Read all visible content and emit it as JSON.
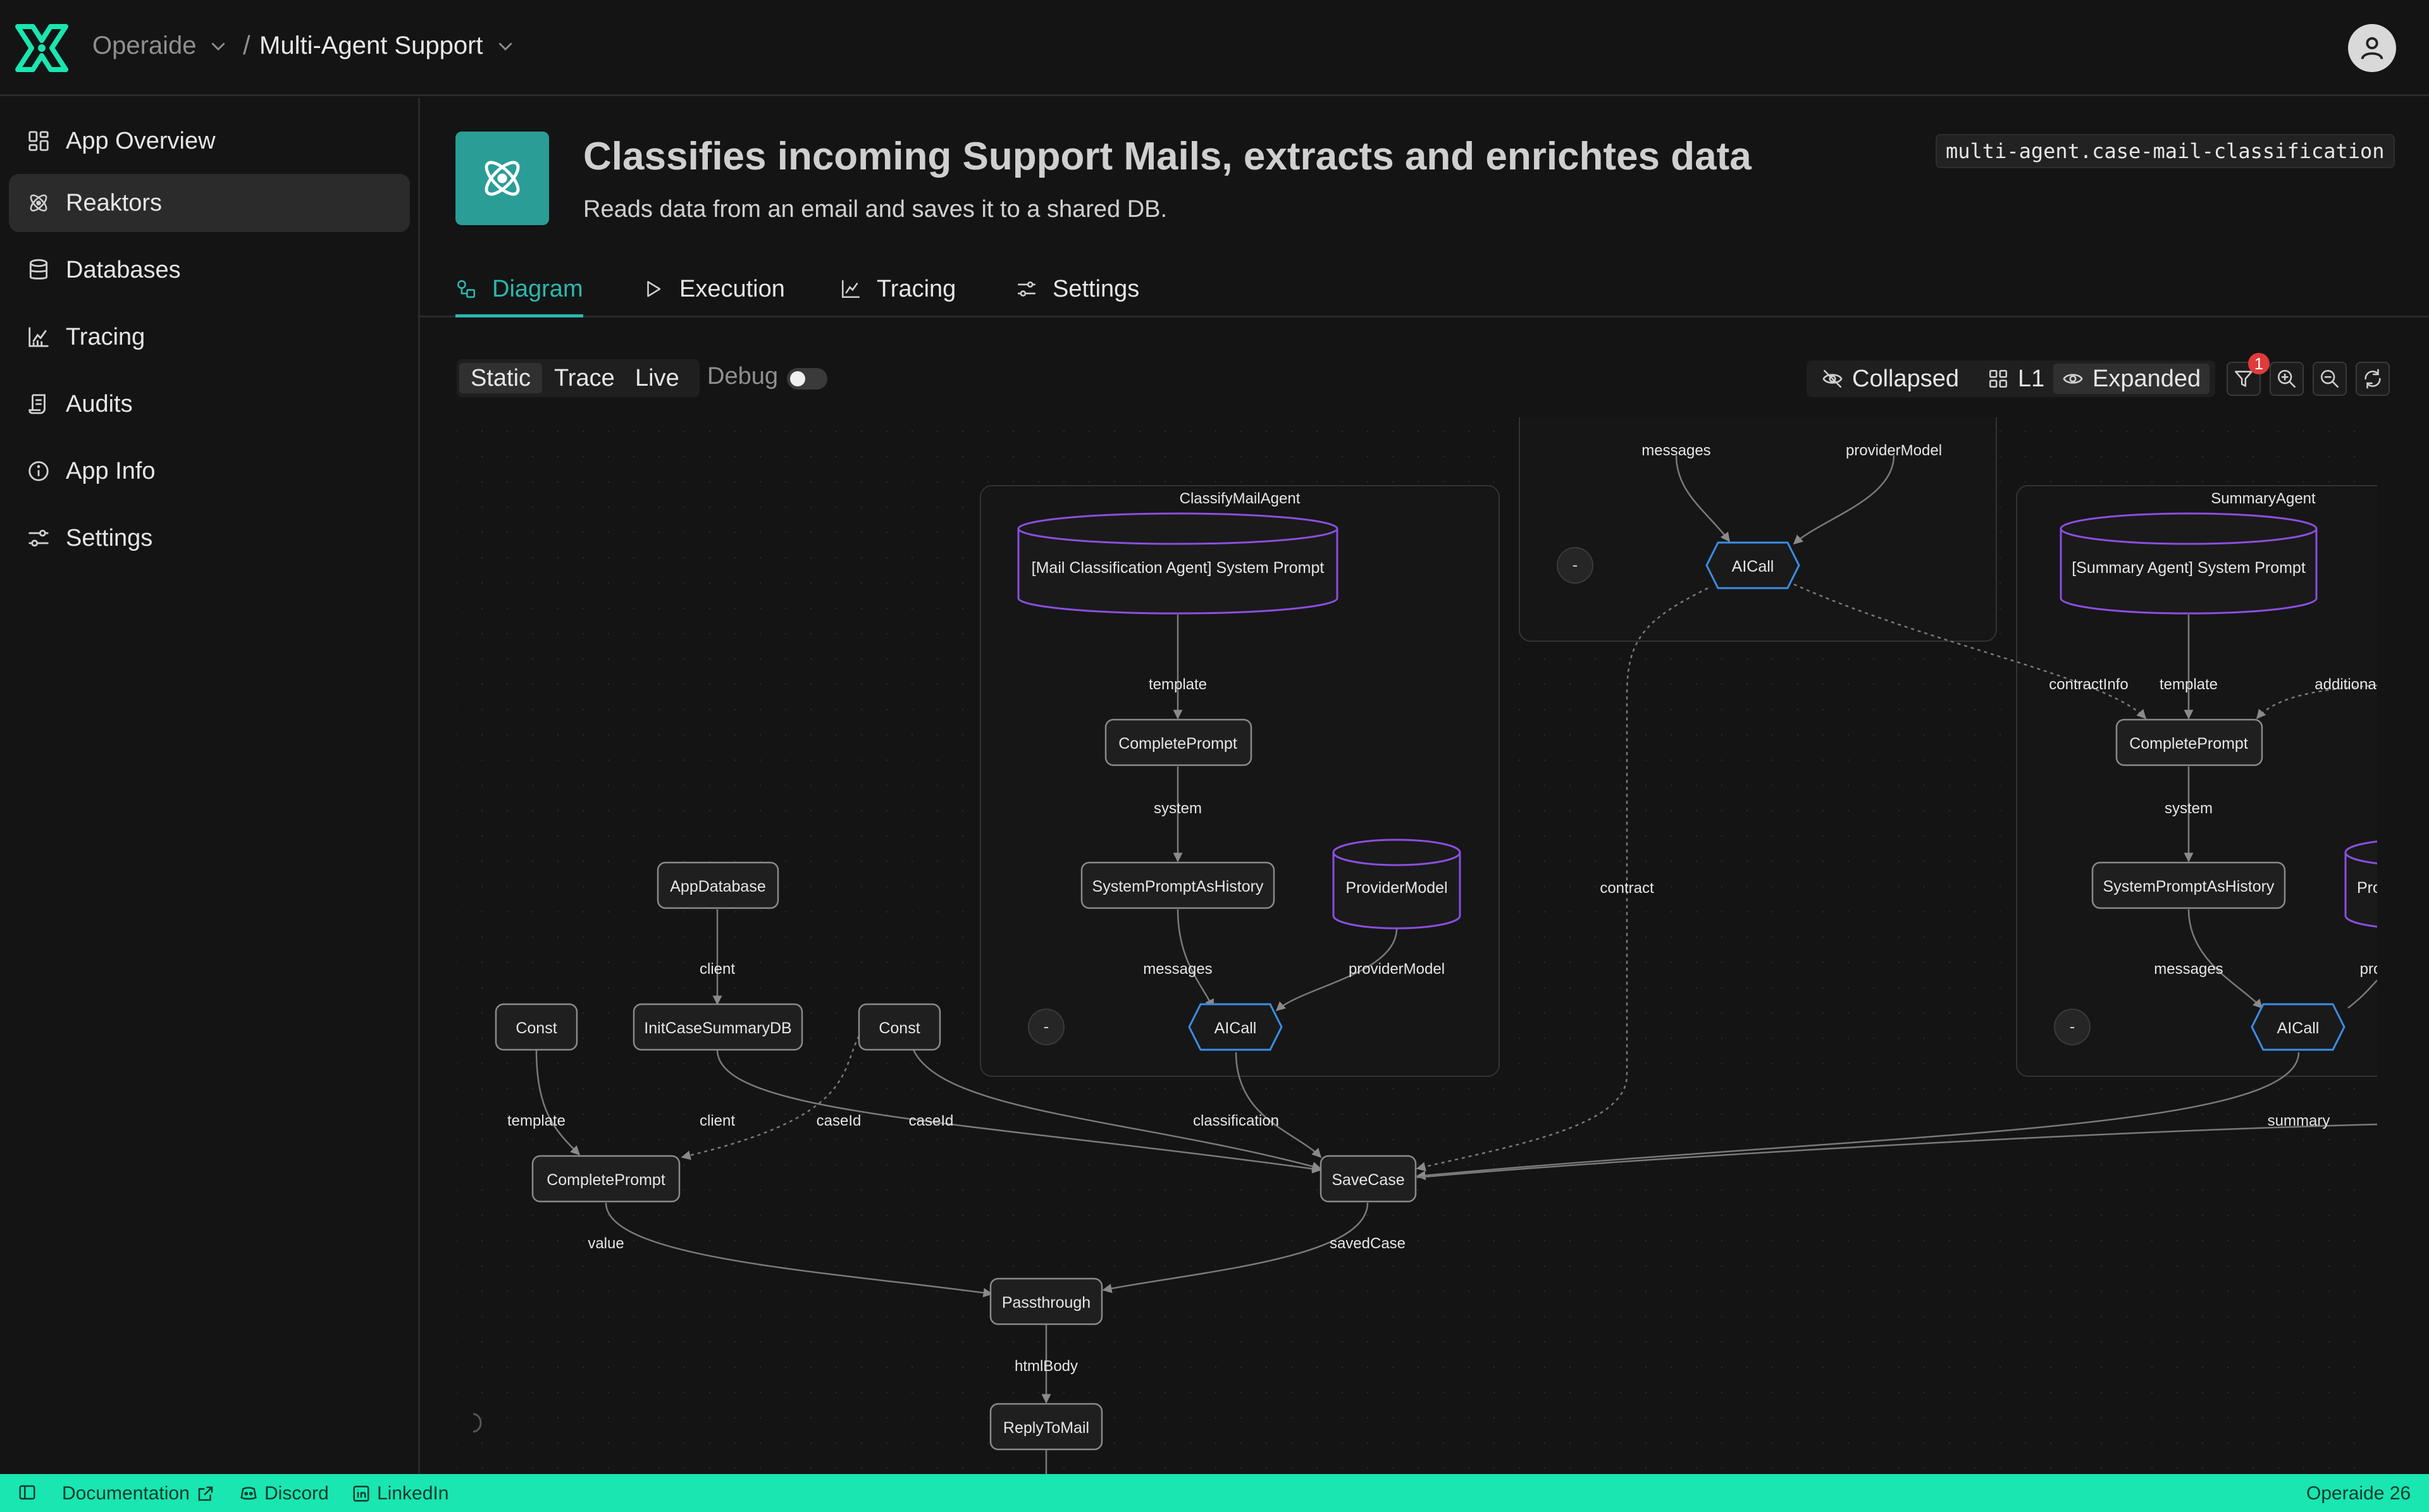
{
  "breadcrumb": {
    "org": "Operaide",
    "app": "Multi-Agent Support"
  },
  "sidebar": {
    "items": [
      {
        "label": "App Overview",
        "icon": "grid-icon"
      },
      {
        "label": "Reaktors",
        "icon": "atom-icon",
        "active": true
      },
      {
        "label": "Databases",
        "icon": "database-icon"
      },
      {
        "label": "Tracing",
        "icon": "chart-icon"
      },
      {
        "label": "Audits",
        "icon": "scroll-icon"
      },
      {
        "label": "App Info",
        "icon": "info-icon"
      },
      {
        "label": "Settings",
        "icon": "sliders-icon"
      }
    ]
  },
  "header": {
    "title": "Classifies incoming Support Mails, extracts and enrichtes data",
    "description": "Reads data from an email and saves it to a shared DB.",
    "reaktor_id": "multi-agent.case-mail-classification",
    "accent": "#2a9d96"
  },
  "tabs": [
    {
      "label": "Diagram",
      "active": true
    },
    {
      "label": "Execution"
    },
    {
      "label": "Tracing"
    },
    {
      "label": "Settings"
    }
  ],
  "toolbar": {
    "modes": [
      "Static",
      "Trace",
      "Live"
    ],
    "active_mode": "Static",
    "debug_label": "Debug",
    "debug_on": false,
    "views": [
      "Collapsed",
      "L1",
      "Expanded"
    ],
    "active_view": "Expanded",
    "filter_badge": "1"
  },
  "diagram": {
    "groups": {
      "classify": "ClassifyMailAgent",
      "summary": "SummaryAgent",
      "collapse": "-"
    },
    "nodes": {
      "mail_prompt": "[Mail Classification Agent] System Prompt",
      "summary_prompt": "[Summary Agent] System Prompt",
      "complete_prompt": "CompletePrompt",
      "system_history": "SystemPromptAsHistory",
      "provider_model": "ProviderModel",
      "provider_model_cut": "Pro",
      "ai_call": "AICall",
      "app_database": "AppDatabase",
      "init_case": "InitCaseSummaryDB",
      "const": "Const",
      "save_case": "SaveCase",
      "passthrough": "Passthrough",
      "reply": "ReplyToMail"
    },
    "edges": {
      "template": "template",
      "system": "system",
      "messages": "messages",
      "provider_model": "providerModel",
      "provider_model_cut": "pro",
      "client": "client",
      "case_id": "caseId",
      "classification": "classification",
      "contract": "contract",
      "contract_info": "contractInfo",
      "additional": "additiona",
      "summary": "summary",
      "value": "value",
      "saved_case": "savedCase",
      "html_body": "htmlBody"
    }
  },
  "footer": {
    "docs": "Documentation",
    "discord": "Discord",
    "linkedin": "LinkedIn",
    "version": "Operaide 26"
  },
  "colors": {
    "background": "#141414",
    "footer": "#19e6b0",
    "db_node": "#8a4fe0",
    "ai_node": "#3a8ee6"
  }
}
